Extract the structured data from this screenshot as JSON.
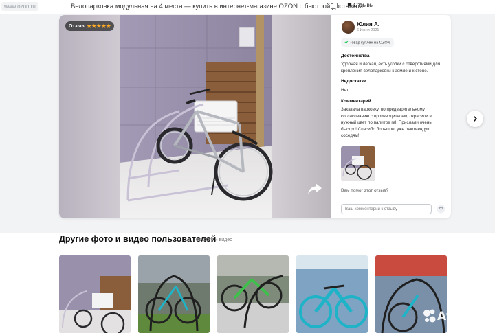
{
  "browser": {
    "url": "www.ozon.ru",
    "page_title": "Велопарковка модульная на 4 места — купить в интернет-магазине OZON с быстрой доставкой",
    "tab_reviews_label": "Отзывы"
  },
  "review": {
    "badge_label": "Отзыв",
    "rating": 5,
    "stars_text": "★★★★★",
    "author": "Юлия А.",
    "date": "6 Июня 2021",
    "verified_label": "Товар куплен на OZON",
    "pros_heading": "Достоинства",
    "pros_text": "Удобная и легкая, есть уголки с отверстиями для крепления велопарковки к земле и к стене.",
    "cons_heading": "Недостатки",
    "cons_text": "Нет",
    "comment_heading": "Комментарий",
    "comment_text": "Заказала парковку, по предварительному согласованию с производителем, окрасили в нужный цвет по палитре ral. Прислали очень быстро! Спасибо большое, уже рекомендую соседям!",
    "helpful_question": "Вам помог этот отзыв?",
    "comment_placeholder": "Ваш комментарий к отзыву"
  },
  "gallery": {
    "title": "Другие фото и видео пользователей",
    "count_label": "11 фото и видео",
    "items": [
      "photo-1",
      "photo-2",
      "photo-3",
      "photo-4",
      "photo-5"
    ]
  },
  "watermark": {
    "brand": "Avito"
  },
  "colors": {
    "star": "#f9a825",
    "wall_purple": "#8e86a3",
    "rack_lavender": "#c9c2d6",
    "teal_bike": "#1fb3c8",
    "green_bike": "#3fbf4b"
  }
}
